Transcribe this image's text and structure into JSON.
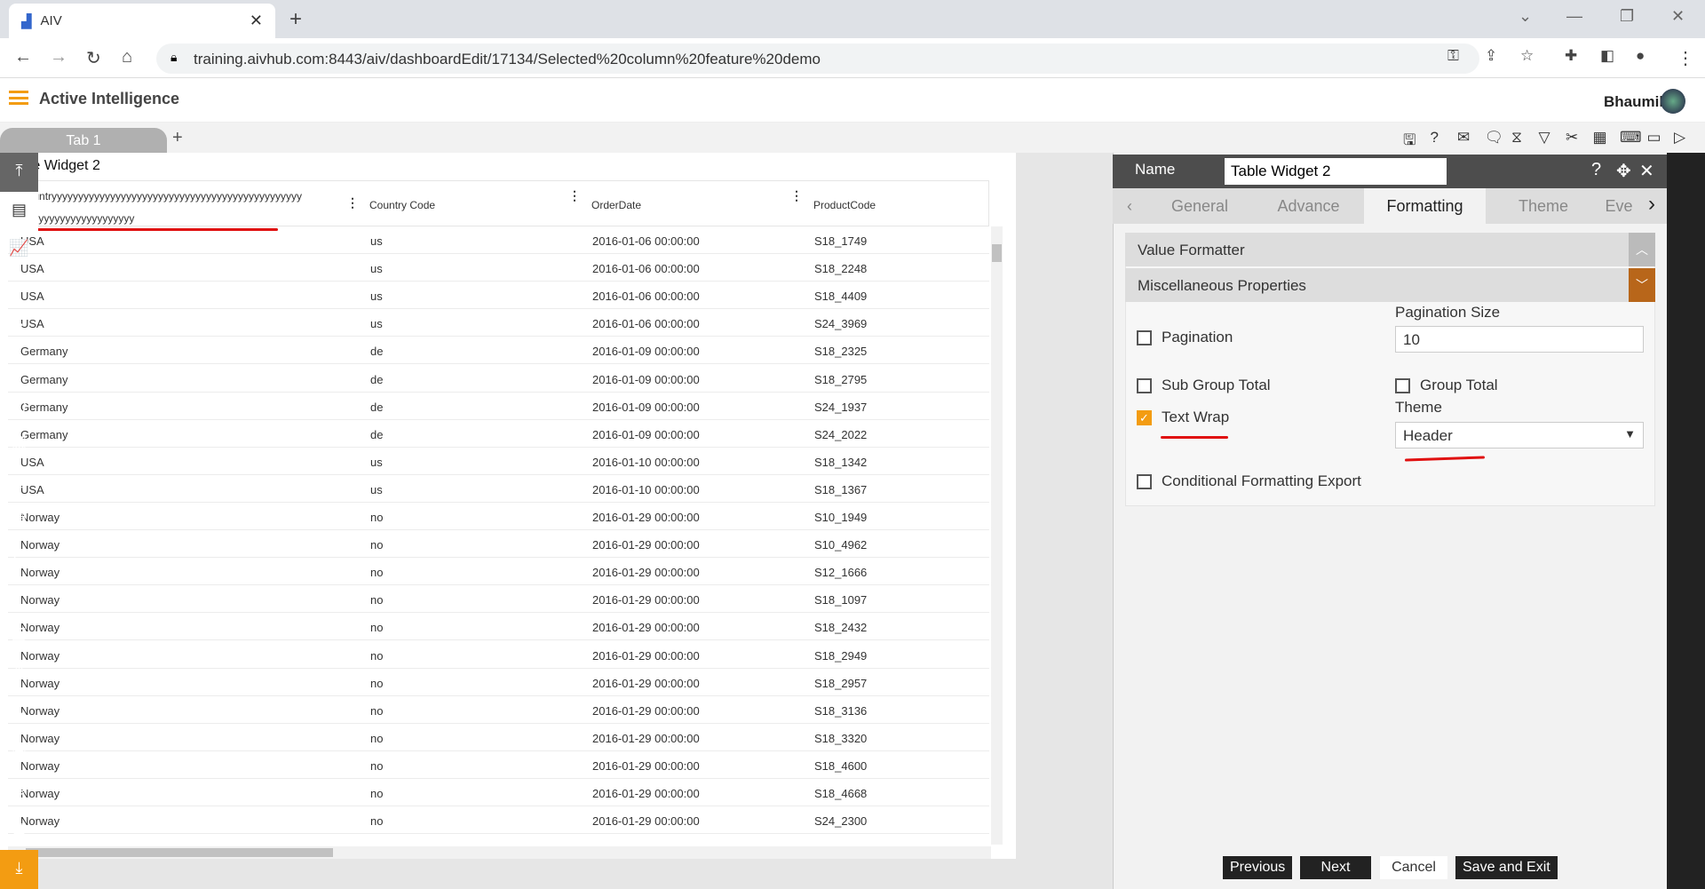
{
  "browser": {
    "tab_title": "AIV",
    "url": "training.aivhub.com:8443/aiv/dashboardEdit/17134/Selected%20column%20feature%20demo"
  },
  "app": {
    "brand": "Active Intelligence",
    "user": "Bhaumik"
  },
  "tabs": {
    "tab1": "Tab 1",
    "add": "+"
  },
  "toolbar": [
    "save-icon",
    "help-icon",
    "mail-icon",
    "comment-icon",
    "clear-filter-icon",
    "filter-icon",
    "tools-icon",
    "table-icon",
    "embed-icon",
    "devices-icon",
    "play-icon"
  ],
  "widget": {
    "title": "Table Widget 2",
    "columns": [
      "Countryyyyyyyyyyyyyyyyyyyyyyyyyyyyyyyyyyyyyyyyyyyyyyyy yyyyyyyyyyyyyyyyyyyy",
      "Country Code",
      "OrderDate",
      "ProductCode"
    ],
    "rows": [
      [
        "USA",
        "us",
        "2016-01-06 00:00:00",
        "S18_1749"
      ],
      [
        "USA",
        "us",
        "2016-01-06 00:00:00",
        "S18_2248"
      ],
      [
        "USA",
        "us",
        "2016-01-06 00:00:00",
        "S18_4409"
      ],
      [
        "USA",
        "us",
        "2016-01-06 00:00:00",
        "S24_3969"
      ],
      [
        "Germany",
        "de",
        "2016-01-09 00:00:00",
        "S18_2325"
      ],
      [
        "Germany",
        "de",
        "2016-01-09 00:00:00",
        "S18_2795"
      ],
      [
        "Germany",
        "de",
        "2016-01-09 00:00:00",
        "S24_1937"
      ],
      [
        "Germany",
        "de",
        "2016-01-09 00:00:00",
        "S24_2022"
      ],
      [
        "USA",
        "us",
        "2016-01-10 00:00:00",
        "S18_1342"
      ],
      [
        "USA",
        "us",
        "2016-01-10 00:00:00",
        "S18_1367"
      ],
      [
        "Norway",
        "no",
        "2016-01-29 00:00:00",
        "S10_1949"
      ],
      [
        "Norway",
        "no",
        "2016-01-29 00:00:00",
        "S10_4962"
      ],
      [
        "Norway",
        "no",
        "2016-01-29 00:00:00",
        "S12_1666"
      ],
      [
        "Norway",
        "no",
        "2016-01-29 00:00:00",
        "S18_1097"
      ],
      [
        "Norway",
        "no",
        "2016-01-29 00:00:00",
        "S18_2432"
      ],
      [
        "Norway",
        "no",
        "2016-01-29 00:00:00",
        "S18_2949"
      ],
      [
        "Norway",
        "no",
        "2016-01-29 00:00:00",
        "S18_2957"
      ],
      [
        "Norway",
        "no",
        "2016-01-29 00:00:00",
        "S18_3136"
      ],
      [
        "Norway",
        "no",
        "2016-01-29 00:00:00",
        "S18_3320"
      ],
      [
        "Norway",
        "no",
        "2016-01-29 00:00:00",
        "S18_4600"
      ],
      [
        "Norway",
        "no",
        "2016-01-29 00:00:00",
        "S18_4668"
      ],
      [
        "Norway",
        "no",
        "2016-01-29 00:00:00",
        "S24_2300"
      ]
    ]
  },
  "panel": {
    "name_label": "Name",
    "name_value": "Table Widget 2",
    "tabs": [
      "General",
      "Advance",
      "Formatting",
      "Theme",
      "Eve"
    ],
    "active_tab": "Formatting",
    "value_formatter": "Value Formatter",
    "misc": "Miscellaneous Properties",
    "pagination": {
      "label": "Pagination",
      "checked": false
    },
    "pagination_size": {
      "label": "Pagination Size",
      "value": "10"
    },
    "sub_group_total": {
      "label": "Sub Group Total",
      "checked": false
    },
    "group_total": {
      "label": "Group Total",
      "checked": false
    },
    "text_wrap": {
      "label": "Text Wrap",
      "checked": true
    },
    "theme": {
      "label": "Theme",
      "value": "Header"
    },
    "cond_export": {
      "label": "Conditional Formatting Export",
      "checked": false
    },
    "buttons": {
      "previous": "Previous",
      "next": "Next",
      "cancel": "Cancel",
      "save_exit": "Save and Exit"
    }
  },
  "sidebar": [
    "collapse-up-icon",
    "table-widget-icon",
    "chart-icon",
    "map-icon",
    "report-icon",
    "document-icon",
    "code-icon",
    "image-icon",
    "pivot-icon",
    "form-icon",
    "tree-icon",
    "scatter-icon",
    "copy-icon",
    "cubes-icon",
    "rx-icon",
    "file-icon",
    "layers-icon",
    "add-grid-icon",
    "download-icon"
  ],
  "colors": {
    "accent": "#f39c12",
    "panel_header": "#4d4d4d",
    "sidebar": "#222222",
    "annotation": "#e01010"
  }
}
